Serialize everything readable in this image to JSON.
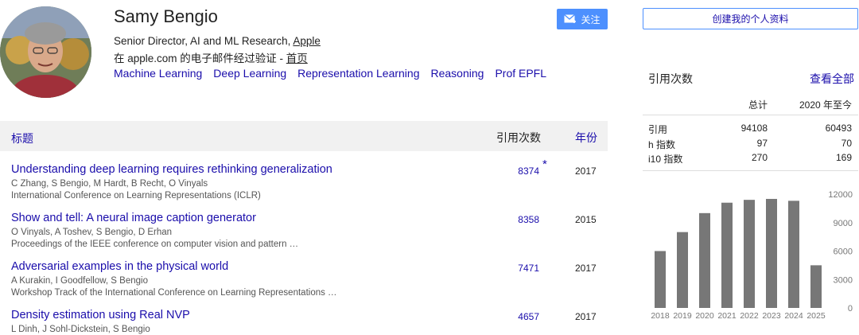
{
  "profile": {
    "name": "Samy Bengio",
    "affiliation_prefix": "Senior Director, AI and ML Research, ",
    "affiliation_link": "Apple",
    "verified_prefix": "在 apple.com 的电子邮件经过验证 - ",
    "verified_link": "首页",
    "interests": [
      "Machine Learning",
      "Deep Learning",
      "Representation Learning",
      "Reasoning",
      "Prof EPFL"
    ]
  },
  "buttons": {
    "follow": "关注",
    "create_profile": "创建我的个人资料"
  },
  "table": {
    "header_title": "标题",
    "header_cited": "引用次数",
    "header_year": "年份",
    "rows": [
      {
        "title": "Understanding deep learning requires rethinking generalization",
        "authors": "C Zhang, S Bengio, M Hardt, B Recht, O Vinyals",
        "venue": "International Conference on Learning Representations (ICLR)",
        "cites": "8374",
        "star": "*",
        "year": "2017"
      },
      {
        "title": "Show and tell: A neural image caption generator",
        "authors": "O Vinyals, A Toshev, S Bengio, D Erhan",
        "venue": "Proceedings of the IEEE conference on computer vision and pattern …",
        "cites": "8358",
        "year": "2015"
      },
      {
        "title": "Adversarial examples in the physical world",
        "authors": "A Kurakin, I Goodfellow, S Bengio",
        "venue": "Workshop Track of the International Conference on Learning Representations …",
        "cites": "7471",
        "year": "2017"
      },
      {
        "title": "Density estimation using Real NVP",
        "authors": "L Dinh, J Sohl-Dickstein, S Bengio",
        "venue": "",
        "cites": "4657",
        "year": "2017"
      }
    ]
  },
  "citations": {
    "title": "引用次数",
    "view_all": "查看全部",
    "col_all": "总计",
    "col_since": "2020 年至今",
    "stats": [
      {
        "label": "引用",
        "all": "94108",
        "since": "60493"
      },
      {
        "label": "h 指数",
        "all": "97",
        "since": "70"
      },
      {
        "label": "i10 指数",
        "all": "270",
        "since": "169"
      }
    ]
  },
  "chart_data": {
    "type": "bar",
    "categories": [
      "2018",
      "2019",
      "2020",
      "2021",
      "2022",
      "2023",
      "2024",
      "2025"
    ],
    "values": [
      6000,
      8000,
      10000,
      11100,
      11400,
      11500,
      11300,
      4500
    ],
    "ylim": [
      0,
      12000
    ],
    "yticks": [
      "12000",
      "9000",
      "6000",
      "3000",
      "0"
    ],
    "bar_color": "#777777"
  },
  "colors": {
    "link": "#1a0dab",
    "accent": "#4d90fe"
  }
}
